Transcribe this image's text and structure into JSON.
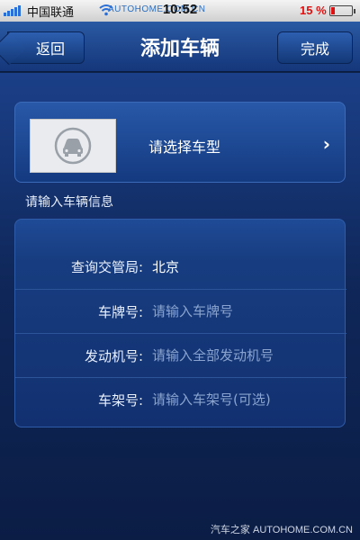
{
  "status_bar": {
    "carrier": "中国联通",
    "watermark": "AUTOHOME.COM.CN",
    "time": "10:52",
    "battery": "15 %"
  },
  "nav": {
    "back_label": "返回",
    "title": "添加车辆",
    "done_label": "完成"
  },
  "vehicle": {
    "select_label": "请选择车型",
    "thumbnail_icon": "car-front-icon"
  },
  "section": {
    "label": "请输入车辆信息"
  },
  "form": {
    "rows": [
      {
        "label": "查询交管局:",
        "value": "北京"
      },
      {
        "label": "车牌号:",
        "placeholder": "请输入车牌号"
      },
      {
        "label": "发动机号:",
        "placeholder": "请输入全部发动机号"
      },
      {
        "label": "车架号:",
        "placeholder": "请输入车架号(可选)"
      }
    ]
  },
  "footer": {
    "watermark": "汽车之家 AUTOHOME.COM.CN"
  },
  "colors": {
    "accent": "#1f4a96",
    "navbar": "#2a5aa3",
    "background": "#0e2146",
    "battery_low": "#dd1111"
  }
}
